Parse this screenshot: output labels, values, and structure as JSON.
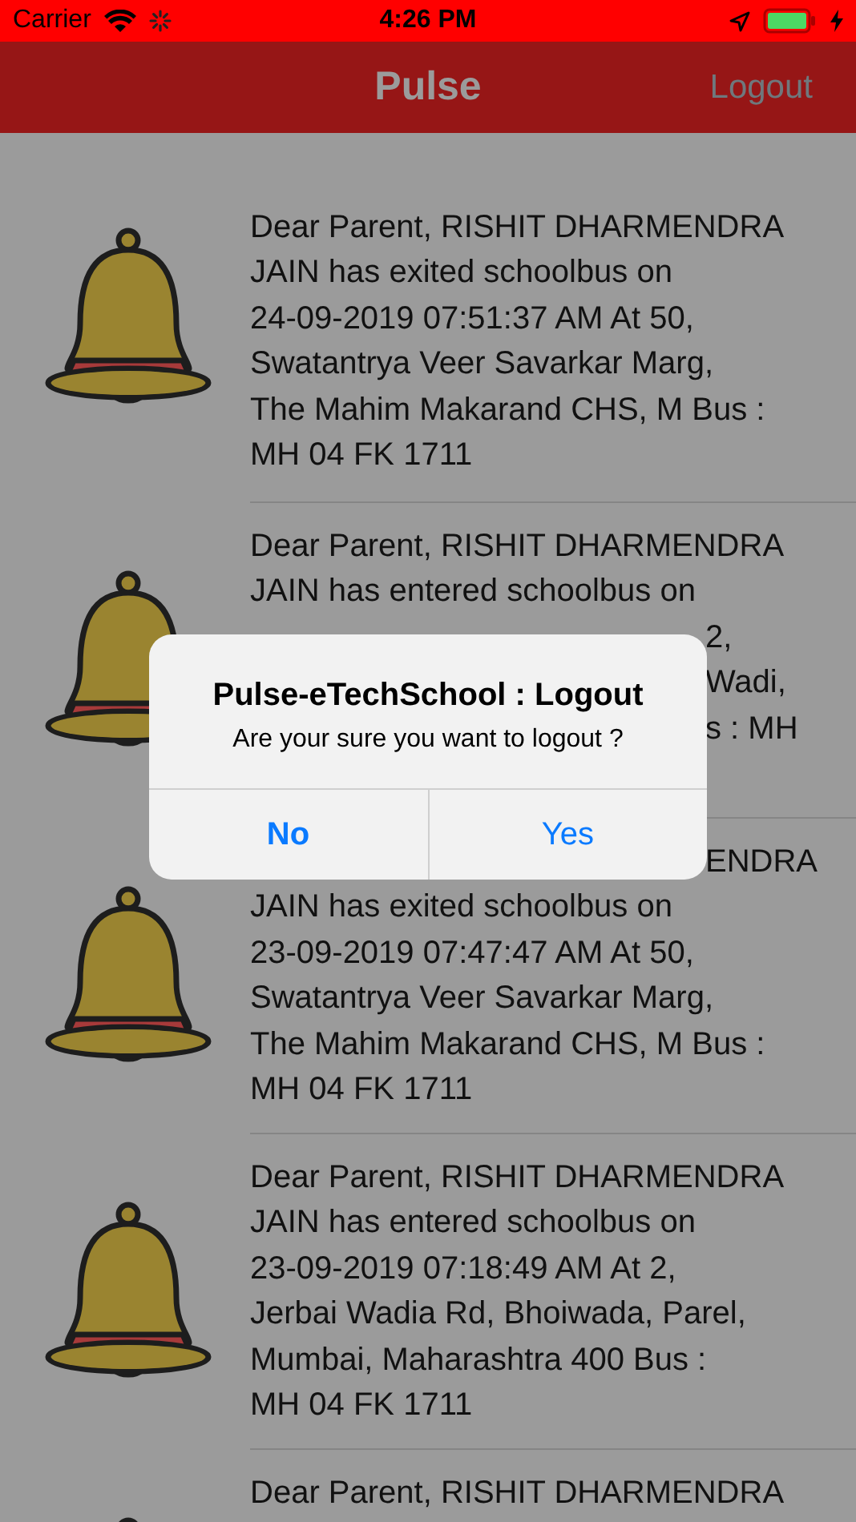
{
  "status_bar": {
    "carrier": "Carrier",
    "time": "4:26 PM"
  },
  "nav_bar": {
    "title": "Pulse",
    "logout": "Logout"
  },
  "notifications": [
    {
      "lines": [
        {
          "text": "Dear Parent, RISHIT DHARMENDRA",
          "kind": "full"
        },
        {
          "text": "JAIN has exited schoolbus on",
          "kind": "full"
        },
        {
          "text": "24-09-2019 07:51:37 AM At 50,",
          "kind": "full"
        },
        {
          "text": "Swatantrya Veer Savarkar Marg,",
          "kind": "full"
        },
        {
          "text": "The Mahim Makarand CHS, M Bus :",
          "kind": "full"
        },
        {
          "text": "MH 04 FK 1711",
          "kind": "full"
        }
      ]
    },
    {
      "lines": [
        {
          "text": "Dear Parent, RISHIT DHARMENDRA",
          "kind": "full"
        },
        {
          "text": "JAIN has entered schoolbus on",
          "kind": "full"
        },
        {
          "text": "2,",
          "kind": "fragment"
        },
        {
          "text": "Wadi,",
          "kind": "fragment"
        },
        {
          "text": "s : MH",
          "kind": "fragment"
        }
      ]
    },
    {
      "lines": [
        {
          "text": "ENDRA",
          "kind": "fragment"
        },
        {
          "text": "JAIN has exited schoolbus on",
          "kind": "full"
        },
        {
          "text": "23-09-2019 07:47:47 AM At 50,",
          "kind": "full"
        },
        {
          "text": "Swatantrya Veer Savarkar Marg,",
          "kind": "full"
        },
        {
          "text": "The Mahim Makarand CHS, M Bus :",
          "kind": "full"
        },
        {
          "text": "MH 04 FK 1711",
          "kind": "full"
        }
      ]
    },
    {
      "lines": [
        {
          "text": "Dear Parent, RISHIT DHARMENDRA",
          "kind": "full"
        },
        {
          "text": "JAIN has entered schoolbus on",
          "kind": "full"
        },
        {
          "text": "23-09-2019 07:18:49 AM At 2,",
          "kind": "full"
        },
        {
          "text": "Jerbai Wadia Rd, Bhoiwada, Parel,",
          "kind": "full"
        },
        {
          "text": "Mumbai, Maharashtra 400 Bus :",
          "kind": "full"
        },
        {
          "text": "MH 04 FK 1711",
          "kind": "full"
        }
      ]
    },
    {
      "lines": [
        {
          "text": "Dear Parent, RISHIT DHARMENDRA",
          "kind": "full"
        }
      ]
    }
  ],
  "alert": {
    "title": "Pulse-eTechSchool : Logout",
    "message": "Are your sure you want to logout ?",
    "buttons": [
      {
        "label": "No",
        "kind": "cancel"
      },
      {
        "label": "Yes",
        "kind": "default"
      }
    ]
  }
}
